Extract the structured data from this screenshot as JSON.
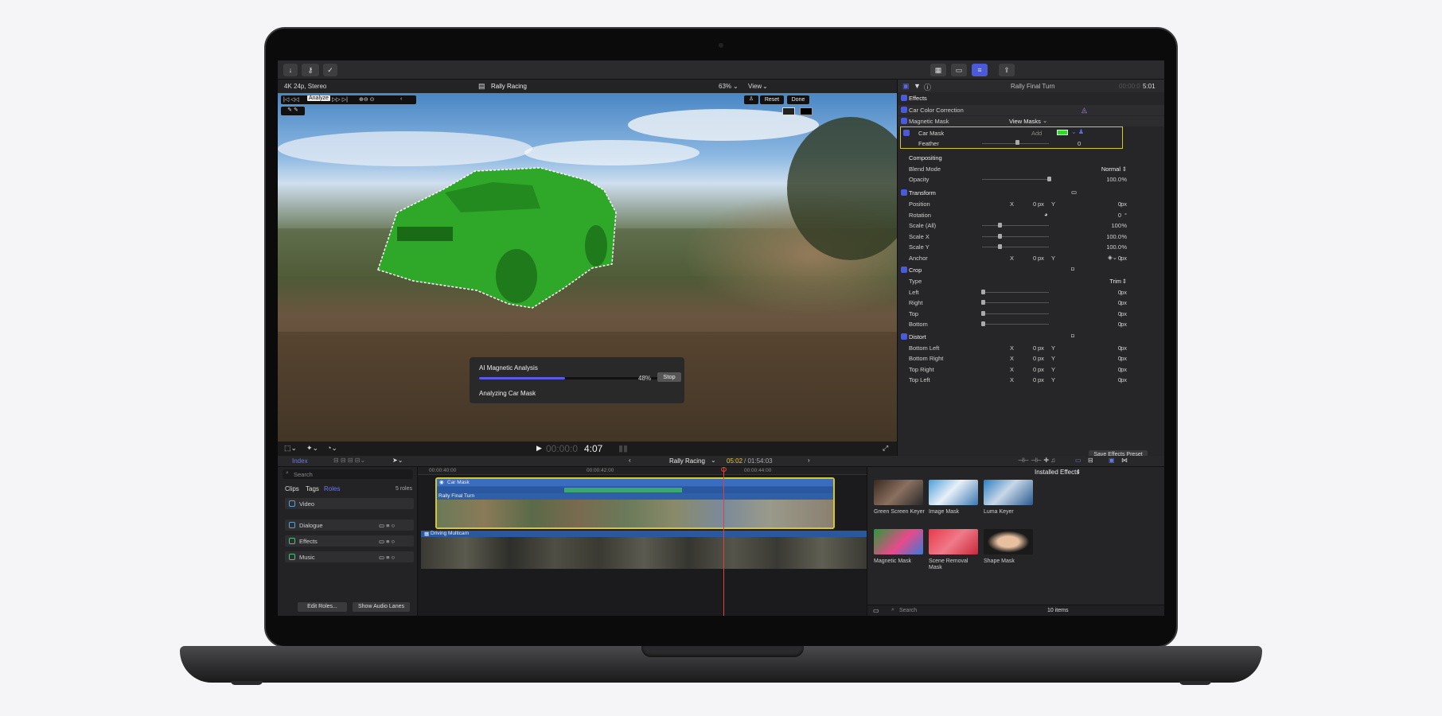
{
  "window": {
    "project_title": "Rally Racing",
    "format": "4K 24p, Stereo",
    "zoom": "63%",
    "view_menu": "View"
  },
  "viewer": {
    "controls": {
      "analyze": "Analyze",
      "reset": "Reset",
      "done": "Done"
    },
    "analysis": {
      "title": "AI Magnetic Analysis",
      "progress": 0.48,
      "percent": "48%",
      "stop": "Stop",
      "status": "Analyzing Car Mask"
    },
    "timecode": "00:00:04:07",
    "timecode_dim": "00:00:0",
    "timecode_bright": "4:07"
  },
  "inspector": {
    "clip_title": "Rally Final Turn",
    "duration_dim": "00:00:0",
    "duration_bright": "5:01",
    "effects_header": "Effects",
    "effects": [
      {
        "label": "Car Color Correction"
      },
      {
        "label": "Magnetic Mask",
        "menu": "View Masks"
      }
    ],
    "car_mask": {
      "label": "Car Mask",
      "add": "Add",
      "feather_label": "Feather",
      "feather_value": "0"
    },
    "compositing": {
      "header": "Compositing",
      "blend_label": "Blend Mode",
      "blend_value": "Normal",
      "opacity_label": "Opacity",
      "opacity_value": "100.0",
      "opacity_unit": "%"
    },
    "transform": {
      "header": "Transform",
      "rows": [
        {
          "label": "Position",
          "x": "0",
          "y": "0",
          "unit": "px"
        },
        {
          "label": "Rotation",
          "value": "0",
          "unit": "°"
        },
        {
          "label": "Scale (All)",
          "value": "100",
          "unit": "%"
        },
        {
          "label": "Scale X",
          "value": "100.0",
          "unit": "%"
        },
        {
          "label": "Scale Y",
          "value": "100.0",
          "unit": "%"
        },
        {
          "label": "Anchor",
          "x": "0",
          "y": "0",
          "unit": "px"
        }
      ]
    },
    "crop": {
      "header": "Crop",
      "type_label": "Type",
      "type_value": "Trim",
      "rows": [
        {
          "label": "Left",
          "value": "0",
          "unit": "px"
        },
        {
          "label": "Right",
          "value": "0",
          "unit": "px"
        },
        {
          "label": "Top",
          "value": "0",
          "unit": "px"
        },
        {
          "label": "Bottom",
          "value": "0",
          "unit": "px"
        }
      ]
    },
    "distort": {
      "header": "Distort",
      "rows": [
        {
          "label": "Bottom Left",
          "x": "0",
          "y": "0",
          "unit": "px"
        },
        {
          "label": "Bottom Right",
          "x": "0",
          "y": "0",
          "unit": "px"
        },
        {
          "label": "Top Right",
          "x": "0",
          "y": "0",
          "unit": "px"
        },
        {
          "label": "Top Left",
          "x": "0",
          "y": "0",
          "unit": "px"
        }
      ]
    },
    "axis_x": "X",
    "axis_y": "Y",
    "save_preset": "Save Effects Preset"
  },
  "browser": {
    "index_label": "Index",
    "search_placeholder": "Search",
    "tabs": [
      "Clips",
      "Tags",
      "Roles"
    ],
    "roles_count": "5 roles",
    "roles": [
      "Video",
      "Dialogue",
      "Effects",
      "Music"
    ],
    "edit_roles": "Edit Roles...",
    "show_audio_lanes": "Show Audio Lanes"
  },
  "timeline": {
    "project": "Rally Racing",
    "position_current": "05:02",
    "position_total": "/ 01:54:03",
    "ruler": [
      "00:00:40:00",
      "00:00:42:00",
      "00:00:44:00"
    ],
    "clips": {
      "mask": "Car Mask",
      "primary": "Rally Final Turn",
      "multicam": "Driving Multicam"
    }
  },
  "effects_browser": {
    "header": "Installed Effects",
    "items": [
      "Green Screen Keyer",
      "Image Mask",
      "Luma Keyer",
      "Magnetic Mask",
      "Scene Removal Mask",
      "Shape Mask"
    ],
    "search_placeholder": "Search",
    "count": "10 items"
  },
  "colors": {
    "accent": "#4a5ad8",
    "mask_green": "#2fa82a",
    "selection_yellow": "#d6c81e",
    "playhead": "#e0423a",
    "timeline_blue": "#2e5fa8"
  }
}
